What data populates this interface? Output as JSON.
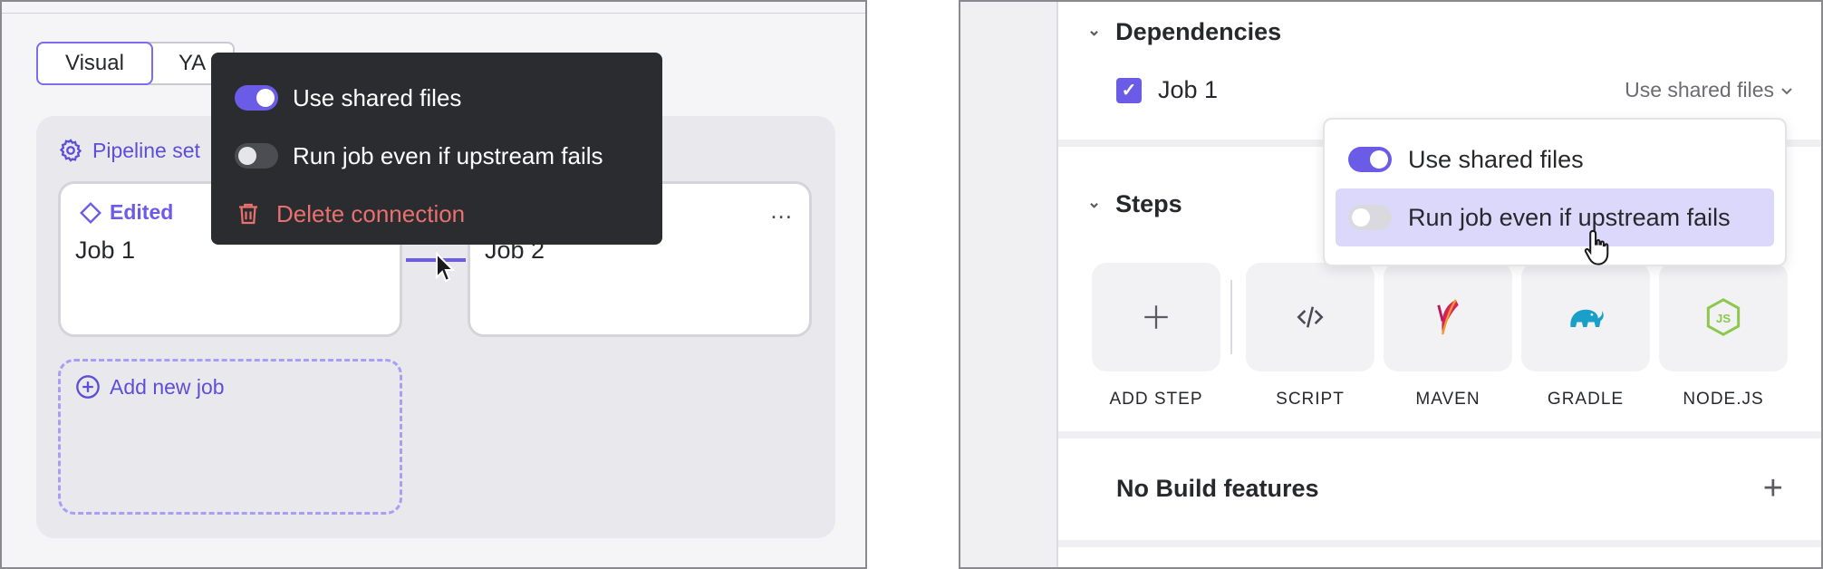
{
  "left": {
    "view_switch": {
      "visual": "Visual",
      "yaml": "YA"
    },
    "pipeline_settings": "Pipeline set",
    "job1": {
      "badge": "Edited",
      "name": "Job 1"
    },
    "job2": {
      "name": "Job 2",
      "menu": "..."
    },
    "add_job": "Add new job",
    "popup": {
      "use_shared_files": "Use shared files",
      "run_even_if_fails": "Run job even if upstream fails",
      "delete_connection": "Delete connection"
    }
  },
  "right": {
    "dependencies": {
      "title": "Dependencies",
      "job": "Job 1",
      "select_value": "Use shared files"
    },
    "popup": {
      "use_shared_files": "Use shared files",
      "run_even_if_fails": "Run job even if upstream fails"
    },
    "steps": {
      "title": "Steps",
      "tiles": [
        {
          "label": "ADD STEP",
          "icon": "plus-icon"
        },
        {
          "label": "SCRIPT",
          "icon": "code-icon"
        },
        {
          "label": "MAVEN",
          "icon": "maven-feather-icon"
        },
        {
          "label": "GRADLE",
          "icon": "gradle-elephant-icon"
        },
        {
          "label": "NODE.JS",
          "icon": "nodejs-hexagon-icon"
        }
      ]
    },
    "build_features": "No Build features"
  },
  "colors": {
    "accent": "#6b5ce7",
    "popup_dark": "#2b2c30",
    "delete": "#e8716d",
    "hover_row": "#dcd8fb"
  }
}
